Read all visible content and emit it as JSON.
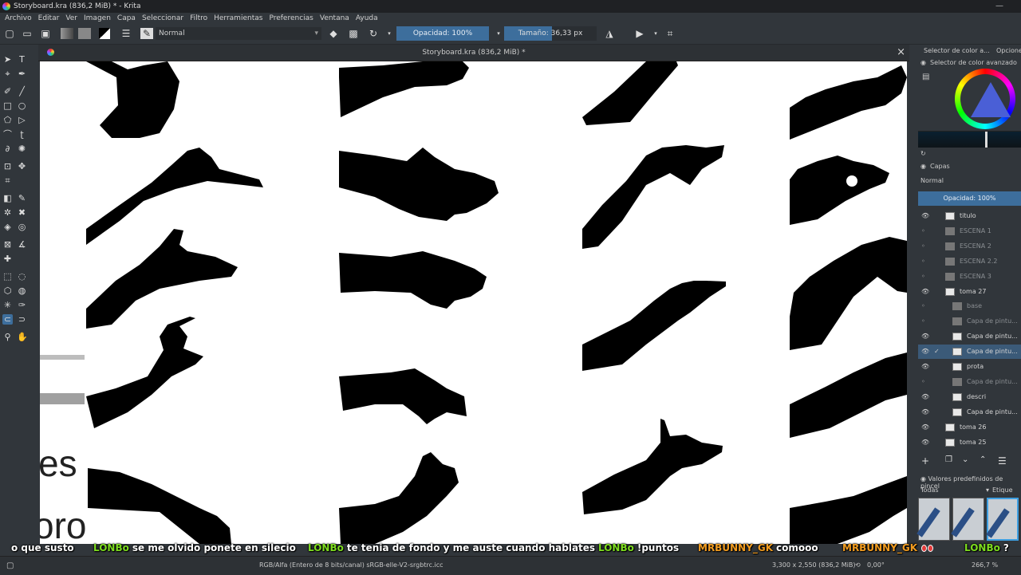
{
  "window": {
    "title": "Storyboard.kra (836,2 MiB) * - Krita",
    "app_icon": "krita-icon"
  },
  "menu": [
    "Archivo",
    "Editar",
    "Ver",
    "Imagen",
    "Capa",
    "Seleccionar",
    "Filtro",
    "Herramientas",
    "Preferencias",
    "Ventana",
    "Ayuda"
  ],
  "toolbar": {
    "blend_mode": "Normal",
    "opacity_label": "Opacidad: 100%",
    "opacity_value": 1.0,
    "size_label": "Tamaño: 36,33 px"
  },
  "document": {
    "tab_title": "Storyboard.kra (836,2 MiB) *"
  },
  "canvas_text": {
    "partial_word_1": "es",
    "partial_word_2": "oro"
  },
  "dock": {
    "tab_color": "Selector de color a...",
    "tab_options": "Opcione",
    "color_selector_title": "Selector de color avanzado",
    "layers_title": "Capas",
    "layers_blend": "Normal",
    "layers_opacity": "Opacidad:  100%",
    "presets_title": "Valores predefinidos de pincel",
    "presets_filter": "Todas",
    "presets_tag": "Etique"
  },
  "layers": [
    {
      "name": "titulo",
      "visible": true,
      "dim": false,
      "type": "group"
    },
    {
      "name": "ESCENA 1",
      "visible": false,
      "dim": true,
      "type": "group"
    },
    {
      "name": "ESCENA 2",
      "visible": false,
      "dim": true,
      "type": "group"
    },
    {
      "name": "ESCENA 2.2",
      "visible": false,
      "dim": true,
      "type": "group"
    },
    {
      "name": "ESCENA 3",
      "visible": false,
      "dim": true,
      "type": "group"
    },
    {
      "name": "toma 27",
      "visible": true,
      "dim": false,
      "type": "group"
    },
    {
      "name": "base",
      "visible": false,
      "dim": true,
      "type": "paint"
    },
    {
      "name": "Capa de pintu...",
      "visible": false,
      "dim": true,
      "type": "paint"
    },
    {
      "name": "Capa de pintu...",
      "visible": true,
      "dim": false,
      "type": "paint"
    },
    {
      "name": "Capa de pintu...",
      "visible": true,
      "dim": false,
      "type": "paint",
      "selected": true
    },
    {
      "name": "prota",
      "visible": true,
      "dim": false,
      "type": "paint"
    },
    {
      "name": "Capa de pintu...",
      "visible": false,
      "dim": true,
      "type": "paint"
    },
    {
      "name": "descri",
      "visible": true,
      "dim": false,
      "type": "paint"
    },
    {
      "name": "Capa de pintu...",
      "visible": true,
      "dim": false,
      "type": "paint"
    },
    {
      "name": "toma 26",
      "visible": true,
      "dim": false,
      "type": "group"
    },
    {
      "name": "toma 25",
      "visible": true,
      "dim": false,
      "type": "group"
    }
  ],
  "status": {
    "color_space": "RGB/Alfa (Entero de 8 bits/canal)  sRGB-elle-V2-srgbtrc.icc",
    "dimensions": "3,300 x 2,550 (836,2 MiB)",
    "rotation": "0,00°",
    "zoom": "266,7 %"
  },
  "chat": [
    {
      "user": "",
      "text": "o que susto",
      "user_color": "#ffffff"
    },
    {
      "user": "LONBo",
      "text": "se me olvido ponete en silecio",
      "user_color": "#7ddc1f"
    },
    {
      "user": "LONBo",
      "text": "te tenia de fondo y me auste cuando hablates",
      "user_color": "#7ddc1f"
    },
    {
      "user": "LONBo",
      "text": "!puntos",
      "user_color": "#7ddc1f"
    },
    {
      "user": "MRBUNNY_GK",
      "text": "comooo",
      "user_color": "#f29c1f"
    },
    {
      "user": "MRBUNNY_GK",
      "text": "",
      "user_color": "#f29c1f"
    },
    {
      "user": "LONBo",
      "text": "?",
      "user_color": "#7ddc1f"
    }
  ]
}
